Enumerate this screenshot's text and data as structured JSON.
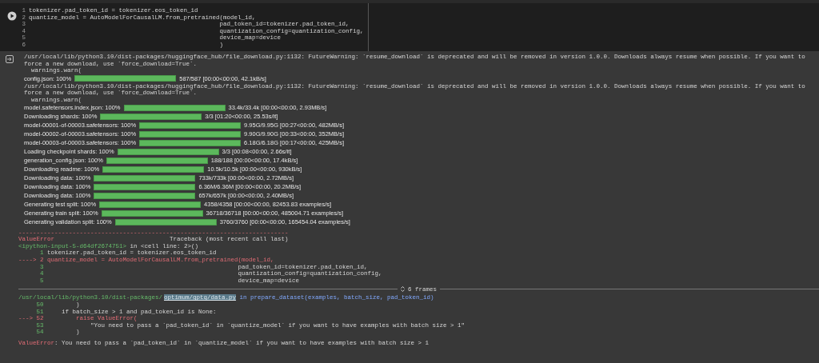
{
  "code_cell": {
    "lines": [
      {
        "number": "1",
        "code": "tokenizer.pad_token_id = tokenizer.eos_token_id"
      },
      {
        "number": "2",
        "code": "quantize_model = AutoModelForCausalLM.from_pretrained(model_id,"
      },
      {
        "number": "3",
        "code": "                                                     pad_token_id=tokenizer.pad_token_id,"
      },
      {
        "number": "4",
        "code": "                                                     quantization_config=quantization_config,"
      },
      {
        "number": "5",
        "code": "                                                     device_map=device"
      },
      {
        "number": "6",
        "code": "                                                     )"
      }
    ]
  },
  "output": [
    {
      "kind": "text",
      "lines": [
        "/usr/local/lib/python3.10/dist-packages/huggingface_hub/file_download.py:1132: FutureWarning: `resume_download` is deprecated and will be removed in version 1.0.0. Downloads always resume when possible. If you want to force a new download, use `force_download=True`.",
        "  warnings.warn("
      ]
    },
    {
      "kind": "progress",
      "label": "config.json: 100%",
      "level": 1,
      "stats": "587/587 [00:00<00:00, 42.1kB/s]"
    },
    {
      "kind": "text",
      "lines": [
        "/usr/local/lib/python3.10/dist-packages/huggingface_hub/file_download.py:1132: FutureWarning: `resume_download` is deprecated and will be removed in version 1.0.0. Downloads always resume when possible. If you want to force a new download, use `force_download=True`.",
        "  warnings.warn("
      ]
    },
    {
      "kind": "progress",
      "label": "model.safetensors.index.json: 100%",
      "level": 1,
      "stats": "33.4k/33.4k [00:00<00:00, 2.93MB/s]"
    },
    {
      "kind": "progress",
      "label": "Downloading shards: 100%",
      "level": 1,
      "stats": "3/3 [01:20<00:00, 25.53s/it]"
    },
    {
      "kind": "progress",
      "label": "model-00001-of-00003.safetensors: 100%",
      "level": 1,
      "stats": "9.95G/9.95G [00:27<00:00, 482MB/s]"
    },
    {
      "kind": "progress",
      "label": "model-00002-of-00003.safetensors: 100%",
      "level": 1,
      "stats": "9.90G/9.90G [00:33<00:00, 352MB/s]"
    },
    {
      "kind": "progress",
      "label": "model-00003-of-00003.safetensors: 100%",
      "level": 1,
      "stats": "6.18G/6.18G [00:17<00:00, 425MB/s]"
    },
    {
      "kind": "progress",
      "label": "Loading checkpoint shards: 100%",
      "level": 1,
      "stats": "3/3 [00:08<00:00,  2.66s/it]"
    },
    {
      "kind": "progress",
      "label": "generation_config.json: 100%",
      "level": 1,
      "stats": "188/188 [00:00<00:00, 17.4kB/s]"
    },
    {
      "kind": "progress",
      "label": "Downloading readme: 100%",
      "level": 1,
      "stats": "10.5k/10.5k [00:00<00:00, 930kB/s]"
    },
    {
      "kind": "progress",
      "label": "Downloading data: 100%",
      "level": 1,
      "stats": "733k/733k [00:00<00:00, 2.72MB/s]"
    },
    {
      "kind": "progress",
      "label": "Downloading data: 100%",
      "level": 1,
      "stats": "6.36M/6.36M [00:00<00:00, 20.2MB/s]"
    },
    {
      "kind": "progress",
      "label": "Downloading data: 100%",
      "level": 1,
      "stats": "657k/657k [00:00<00:00, 2.40MB/s]"
    },
    {
      "kind": "progress",
      "label": "Generating test split: 100%",
      "level": 1,
      "stats": "4358/4358 [00:00<00:00, 82453.83 examples/s]"
    },
    {
      "kind": "progress",
      "label": "Generating train split: 100%",
      "level": 1,
      "stats": "36718/36718 [00:00<00:00, 485004.71 examples/s]"
    },
    {
      "kind": "progress",
      "label": "Generating validation split: 100%",
      "level": 1,
      "stats": "3760/3760 [00:00<00:00, 165454.04 examples/s]"
    }
  ],
  "traceback": {
    "rule": "---------------------------------------------------------------------------",
    "error_type": "ValueError",
    "header": "Traceback (most recent call last)",
    "location": "<ipython-input-5-d64df2674751>",
    "location_suffix": " in <cell line: 2>()",
    "lines": [
      {
        "number": "1",
        "current": false,
        "code": "tokenizer.pad_token_id = tokenizer.eos_token_id"
      },
      {
        "arrow": "---->",
        "number": "2",
        "current": true,
        "code": "quantize_model = AutoModelForCausalLM.from_pretrained(model_id,"
      },
      {
        "number": "3",
        "current": false,
        "code": "                                                     pad_token_id=tokenizer.pad_token_id,"
      },
      {
        "number": "4",
        "current": false,
        "code": "                                                     quantization_config=quantization_config,"
      },
      {
        "number": "5",
        "current": false,
        "code": "                                                     device_map=device"
      }
    ],
    "frames": "6 frames",
    "file_prefix": "/usr/local/lib/python3.10/dist-packages/",
    "file_link": "optimum/gptq/data.py",
    "file_suffix": " in prepare_dataset(examples, batch_size, pad_token_id)",
    "frame_lines": [
      {
        "number": "50",
        "current": false,
        "code": "        )"
      },
      {
        "number": "51",
        "current": false,
        "code": "    if batch_size > 1 and pad_token_id is None:"
      },
      {
        "arrow": "--->",
        "number": "52",
        "current": true,
        "code": "        raise ValueError("
      },
      {
        "number": "53",
        "current": false,
        "code": "            \"You need to pass a `pad_token_id` in `quantize_model` if you want to have examples with batch size > 1\""
      },
      {
        "number": "54",
        "current": false,
        "code": "        )"
      }
    ],
    "error_name": "ValueError",
    "error_message": ": You need to pass a `pad_token_id` in `quantize_model` if you want to have examples with batch size > 1"
  }
}
